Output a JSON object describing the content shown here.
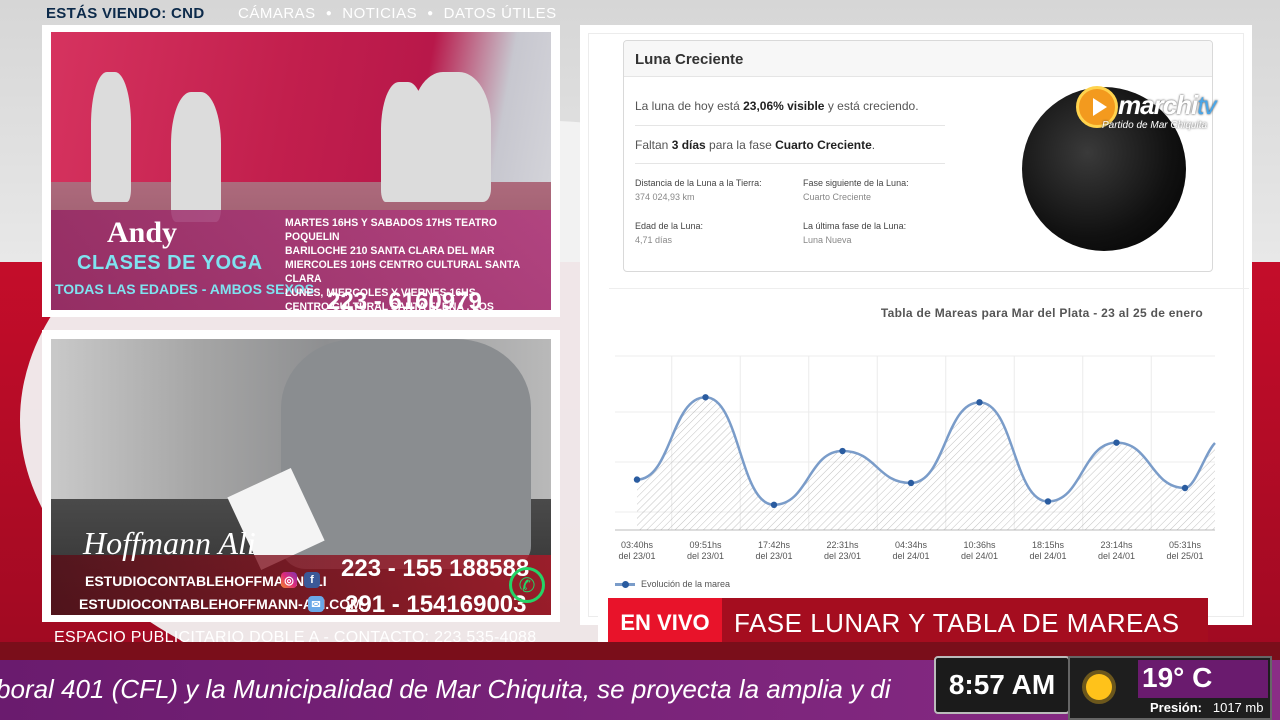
{
  "topbar": {
    "now_viewing": "ESTÁS VIENDO: CND",
    "nav": [
      "CÁMARAS",
      "NOTICIAS",
      "DATOS ÚTILES"
    ]
  },
  "ads": {
    "yoga": {
      "name": "Andy",
      "classes": "CLASES DE YOGA",
      "ages": "TODAS LAS EDADES - AMBOS SEXOS",
      "schedule": [
        "MARTES 16HS Y SABADOS 17HS TEATRO POQUELIN",
        "BARILOCHE 210 SANTA CLARA DEL MAR",
        "MIERCOLES 10HS CENTRO CULTURAL SANTA CLARA",
        "LUNES, MIERCOLES Y VIERNES 16HS",
        "CENTRO CULTURAL SANTA ELENA , LOS NAVEGANTES Y LA COSTA"
      ],
      "phone": "223 - 6160979"
    },
    "hoffmann": {
      "name": "Hoffmann Ali",
      "web1": "ESTUDIOCONTABLEHOFFMANNALI",
      "web2": "ESTUDIOCONTABLEHOFFMANN-ALI.COM",
      "phone1": "223 - 155 188588",
      "phone2": "291 - 154169003"
    },
    "contact": "ESPACIO PUBLICITARIO DOBLE A - CONTACTO: 223 535-4088"
  },
  "moon": {
    "title": "Luna Creciente",
    "line1_pre": "La luna de hoy está ",
    "line1_bold": "23,06% visible",
    "line1_post": " y está creciendo.",
    "line2_pre": "Faltan ",
    "line2_bold1": "3 días",
    "line2_mid": " para la fase ",
    "line2_bold2": "Cuarto Creciente",
    "line2_post": ".",
    "stats": [
      {
        "label": "Distancia de la Luna a la Tierra:",
        "value": "374 024,93 km"
      },
      {
        "label": "Fase siguiente de la Luna:",
        "value": "Cuarto Creciente"
      },
      {
        "label": "Edad de la Luna:",
        "value": "4,71 días"
      },
      {
        "label": "La última fase de la Luna:",
        "value": "Luna Nueva"
      }
    ]
  },
  "logo": {
    "brand": "marchi",
    "brand_tv": "tv",
    "subtitle": "Partido de Mar Chiquita"
  },
  "chart_data": {
    "type": "line",
    "title": "Tabla de Mareas para Mar del Plata - 23 al 25 de enero",
    "xlabel": "",
    "ylabel": "",
    "ylim": [
      0,
      1
    ],
    "categories": [
      "03:40hs del 23/01",
      "09:51hs del 23/01",
      "17:42hs del 23/01",
      "22:31hs del 23/01",
      "04:34hs del 24/01",
      "10:36hs del 24/01",
      "18:15hs del 24/01",
      "23:14hs del 24/01",
      "05:31hs del 25/01"
    ],
    "series": [
      {
        "name": "Evolución de la marea",
        "values": [
          0.3,
          0.79,
          0.15,
          0.47,
          0.28,
          0.76,
          0.17,
          0.52,
          0.25
        ]
      }
    ],
    "legend": "bottom-left",
    "grid": true,
    "colors": {
      "line": "#7a9cc9",
      "point": "#2a5ca0"
    }
  },
  "banner": {
    "live": "EN VIVO",
    "title": "FASE LUNAR Y TABLA DE MAREAS"
  },
  "ticker": {
    "text": "boral 401 (CFL) y la Municipalidad de Mar Chiquita, se proyecta la amplia y di"
  },
  "status": {
    "time": "8:57 AM",
    "temp": "19° C",
    "pressure_label": "Presión:",
    "pressure_value": "1017 mb"
  }
}
